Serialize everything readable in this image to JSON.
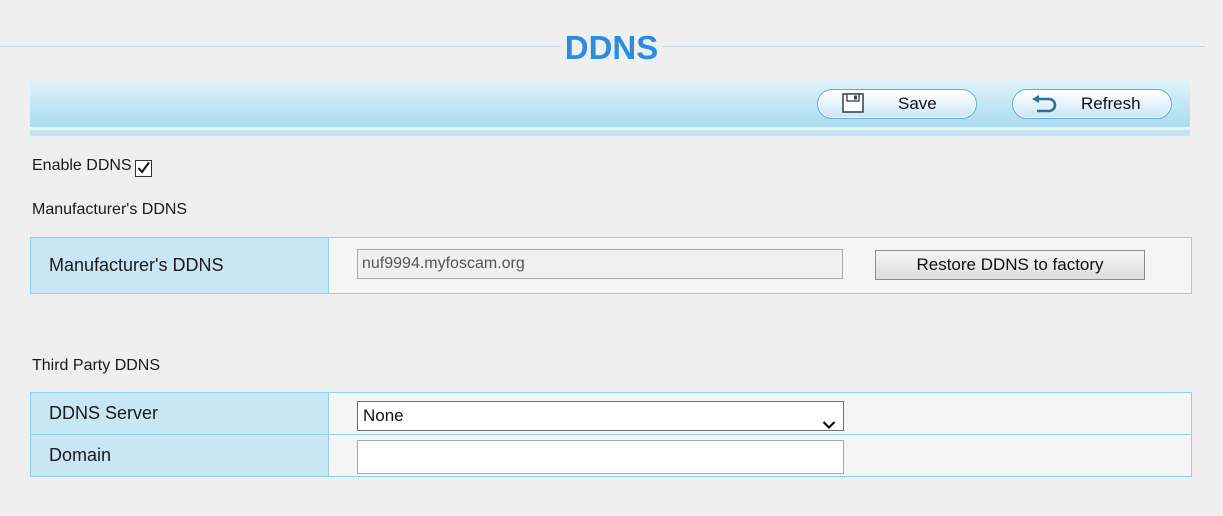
{
  "page": {
    "title": "DDNS"
  },
  "toolbar": {
    "save_label": "Save",
    "refresh_label": "Refresh"
  },
  "enable": {
    "label": "Enable DDNS",
    "checked": true
  },
  "manufacturer": {
    "section_label": "Manufacturer's DDNS",
    "row_label": "Manufacturer's DDNS",
    "value": "nuf9994.myfoscam.org",
    "restore_label": "Restore DDNS to factory"
  },
  "third_party": {
    "section_label": "Third Party DDNS",
    "server_label": "DDNS Server",
    "server_value": "None",
    "domain_label": "Domain",
    "domain_value": ""
  },
  "colors": {
    "title": "#2a8ee0",
    "label_cell": "#c9e6f4",
    "border": "#8fd0ec"
  }
}
